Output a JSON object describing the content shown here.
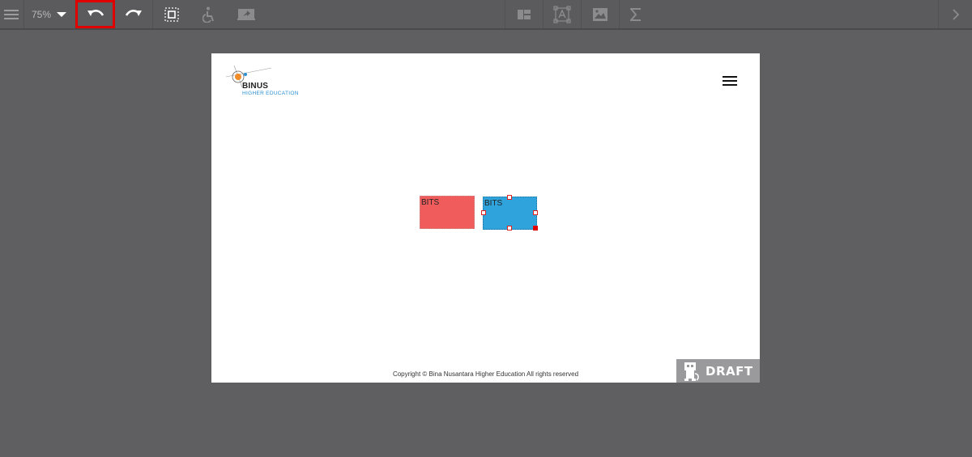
{
  "toolbar": {
    "zoom_label": "75%",
    "highlight_color": "#e00000"
  },
  "page": {
    "logo": {
      "name": "BINUS",
      "subtitle": "HIGHER EDUCATION"
    },
    "shapes": [
      {
        "label": "BITS",
        "color": "#f05c5c"
      },
      {
        "label": "BITS",
        "color": "#2ea3dc",
        "selected": true
      }
    ],
    "copyright": "Copyright © Bina Nusantara Higher Education All rights reserved",
    "draft_label": "DRAFT"
  }
}
